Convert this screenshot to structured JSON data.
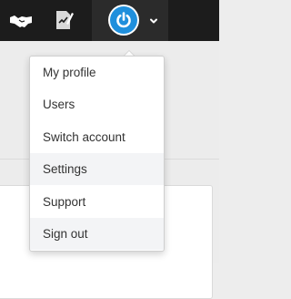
{
  "topbar": {
    "icons": [
      "handshake-icon",
      "contract-sign-icon"
    ],
    "background": "#1c1c1c"
  },
  "account": {
    "avatar_icon": "power-icon",
    "avatar_color": "#1f8fdc",
    "chevron_icon": "chevron-down-icon"
  },
  "menu": {
    "items": [
      {
        "label": "My profile",
        "highlighted": false
      },
      {
        "label": "Users",
        "highlighted": false
      },
      {
        "label": "Switch account",
        "highlighted": false
      },
      {
        "label": "Settings",
        "highlighted": true
      },
      {
        "label": "Support",
        "highlighted": false
      },
      {
        "label": "Sign out",
        "highlighted": true
      }
    ]
  }
}
